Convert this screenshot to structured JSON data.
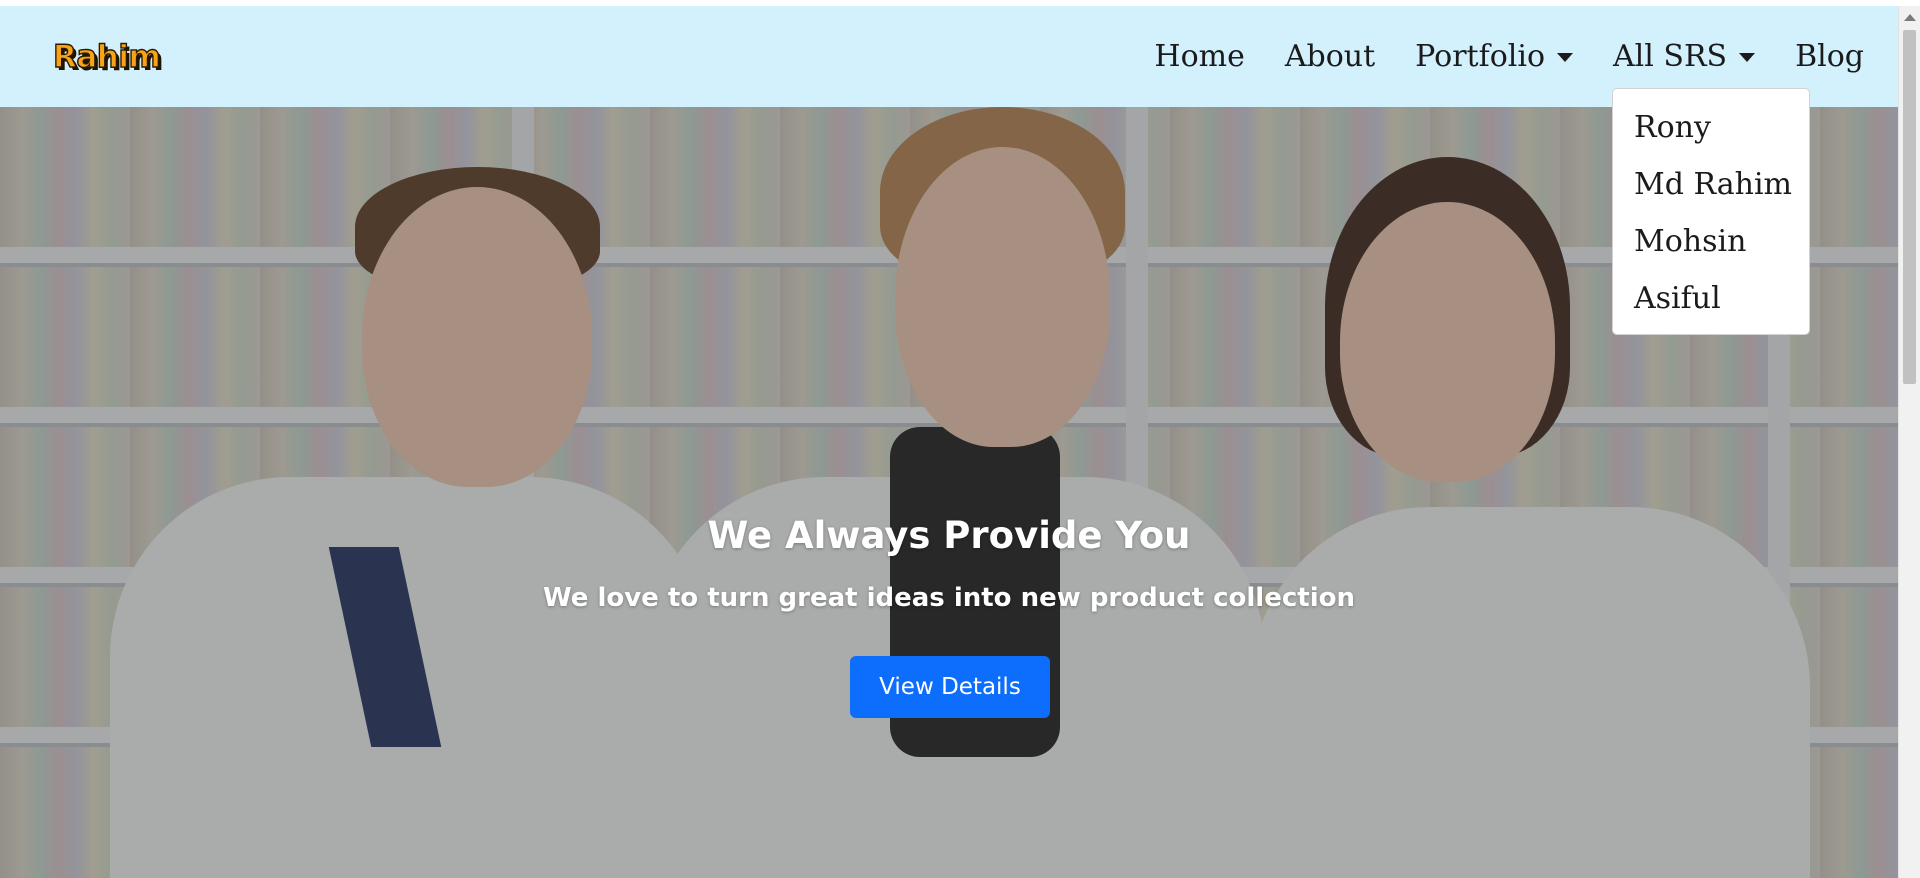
{
  "navbar": {
    "brand": "Rahim",
    "links": {
      "home": "Home",
      "about": "About",
      "portfolio": "Portfolio",
      "all_srs": "All SRS",
      "blog": "Blog"
    }
  },
  "dropdown": {
    "items": [
      "Rony",
      "Md Rahim",
      "Mohsin",
      "Asiful"
    ]
  },
  "hero": {
    "title": "We Always Provide You",
    "subtitle": "We love to turn great ideas into new product collection",
    "button_label": "View Details"
  },
  "colors": {
    "navbar_background": "#d3f1fd",
    "brand_color": "#f9a318",
    "button_background": "#0d6efd"
  },
  "icons": [
    "chevron-down-icon",
    "scroll-up-arrow-icon"
  ]
}
